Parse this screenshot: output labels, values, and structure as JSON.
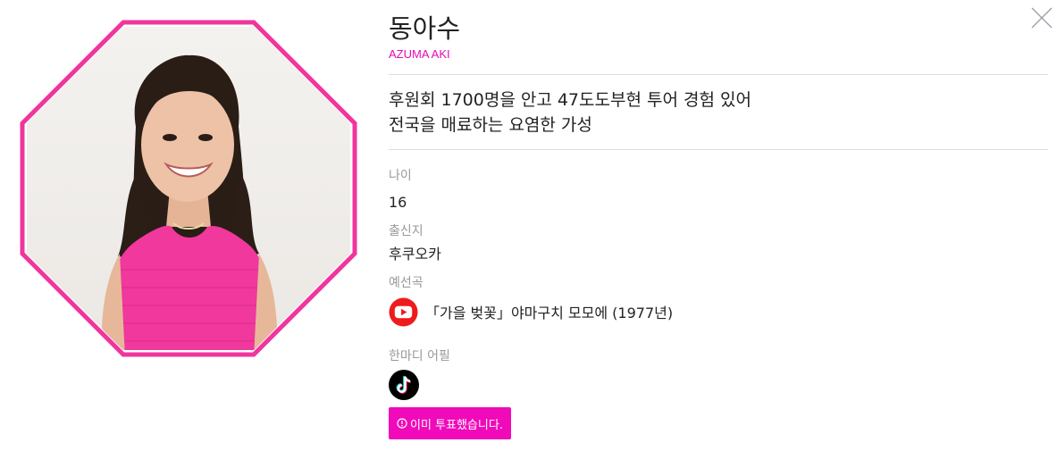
{
  "profile": {
    "name": "동아수",
    "name_en": "AZUMA AKI",
    "catch_lines": [
      "후원회 1700명을 안고 47도도부현 투어 경험 있어",
      "전국을 매료하는 요염한 가성"
    ],
    "age_label": "나이",
    "age": "16",
    "hometown_label": "출신지",
    "hometown": "후쿠오카",
    "song_label": "예선곡",
    "song": "「가을 벚꽃」야마구치 모모에 (1977년)",
    "appeal_label": "한마디 어필",
    "vote_button": "이미 투표했습니다."
  },
  "colors": {
    "accent": "#f00ab9",
    "frame": "#f0359d",
    "youtube": "#ee1c1c",
    "tiktok_bg": "#000000"
  },
  "icons": {
    "close": "close-icon",
    "youtube": "youtube-icon",
    "tiktok": "tiktok-icon",
    "info": "info-icon"
  }
}
